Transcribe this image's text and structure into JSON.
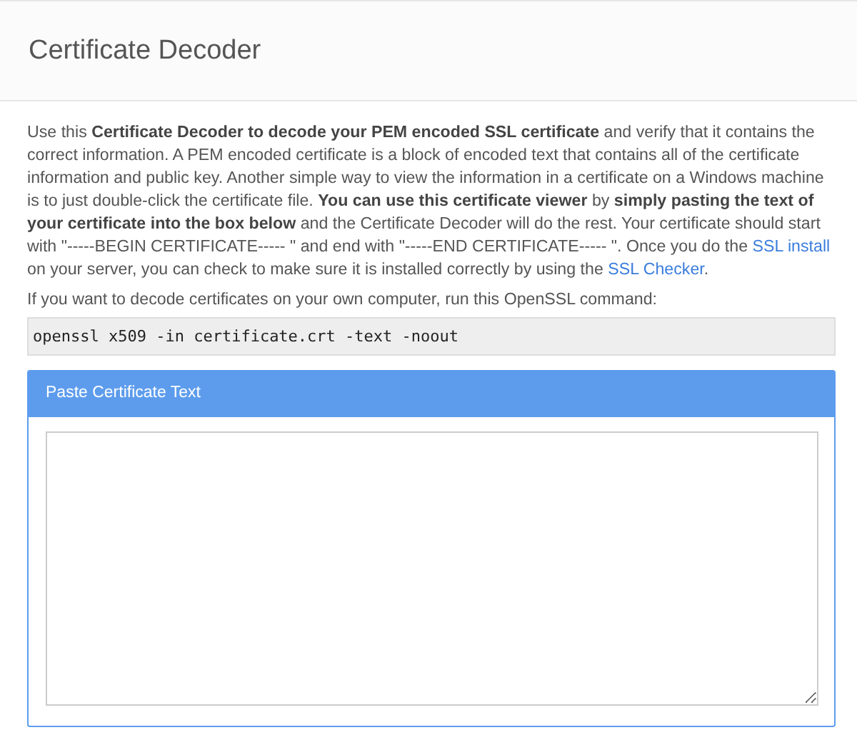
{
  "page_title": "Certificate Decoder",
  "intro": [
    {
      "kind": "text",
      "text": "Use this "
    },
    {
      "kind": "bold",
      "text": "Certificate Decoder to decode your PEM encoded SSL certificate"
    },
    {
      "kind": "text",
      "text": " and verify that it contains the correct information. A PEM encoded certificate is a block of encoded text that contains all of the certificate information and public key. Another simple way to view the information in a certificate on a Windows machine is to just double-click the certificate file. "
    },
    {
      "kind": "bold",
      "text": "You can use this certificate viewer"
    },
    {
      "kind": "text",
      "text": " by "
    },
    {
      "kind": "bold",
      "text": "simply pasting the text of your certificate into the box below"
    },
    {
      "kind": "text",
      "text": " and the Certificate Decoder will do the rest. Your certificate should start with \"-----BEGIN CERTIFICATE----- \" and end with \"-----END CERTIFICATE----- \". Once you do the "
    },
    {
      "kind": "link",
      "text": "SSL install"
    },
    {
      "kind": "text",
      "text": " on your server, you can check to make sure it is installed correctly by using the "
    },
    {
      "kind": "link",
      "text": "SSL Checker"
    },
    {
      "kind": "text",
      "text": "."
    }
  ],
  "command_intro": "If you want to decode certificates on your own computer, run this OpenSSL command:",
  "command": "openssl x509 -in certificate.crt -text -noout",
  "panel": {
    "title": "Paste Certificate Text"
  }
}
